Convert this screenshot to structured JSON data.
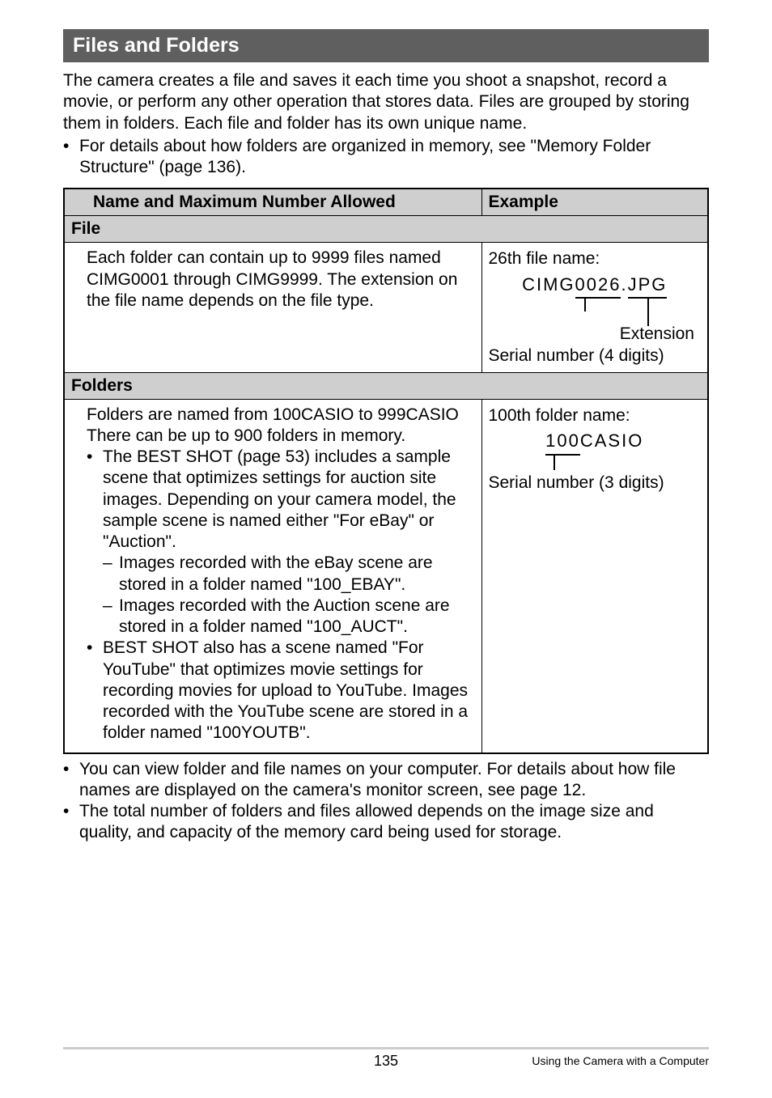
{
  "heading": "Files and Folders",
  "intro": "The camera creates a file and saves it each time you shoot a snapshot, record a movie, or perform any other operation that stores data. Files are grouped by storing them in folders. Each file and folder has its own unique name.",
  "intro_bullet": "For details about how folders are organized in memory, see \"Memory Folder Structure\" (page 136).",
  "table": {
    "col1": "Name and Maximum Number Allowed",
    "col2": "Example",
    "file_section": "File",
    "file_desc": "Each folder can contain up to 9999 files named CIMG0001 through CIMG9999. The extension on the file name depends on the file type.",
    "file_example_intro": "26th file name:",
    "file_example_prefix": "CIMG",
    "file_example_serial": "0026",
    "file_example_dot": ".",
    "file_example_ext": "JPG",
    "file_example_ext_label": "Extension",
    "file_example_serial_label": "Serial number (4 digits)",
    "folders_section": "Folders",
    "folder_desc_l1": "Folders are named from 100CASIO to 999CASIO",
    "folder_desc_l2": "There can be up to 900 folders in memory.",
    "folder_b1": "The BEST SHOT (page 53) includes a sample scene that optimizes settings for auction site images. Depending on your camera model, the sample scene is named either \"For eBay\" or \"Auction\".",
    "folder_b1_d1": "Images recorded with the eBay scene are stored in a folder named \"100_EBAY\".",
    "folder_b1_d2": "Images recorded with the Auction scene are stored in a folder named \"100_AUCT\".",
    "folder_b2": "BEST SHOT also has a scene named \"For YouTube\" that optimizes movie settings for recording movies for upload to YouTube. Images recorded with the YouTube scene are stored in a folder named \"100YOUTB\".",
    "folder_example_intro": "100th folder name:",
    "folder_example_serial": "100",
    "folder_example_suffix": "CASIO",
    "folder_example_serial_label": "Serial number (3 digits)"
  },
  "footer_b1": "You can view folder and file names on your computer. For details about how file names are displayed on the camera's monitor screen, see page 12.",
  "footer_b2": "The total number of folders and files allowed depends on the image size and quality, and capacity of the memory card being used for storage.",
  "page_number": "135",
  "chapter": "Using the Camera with a Computer"
}
